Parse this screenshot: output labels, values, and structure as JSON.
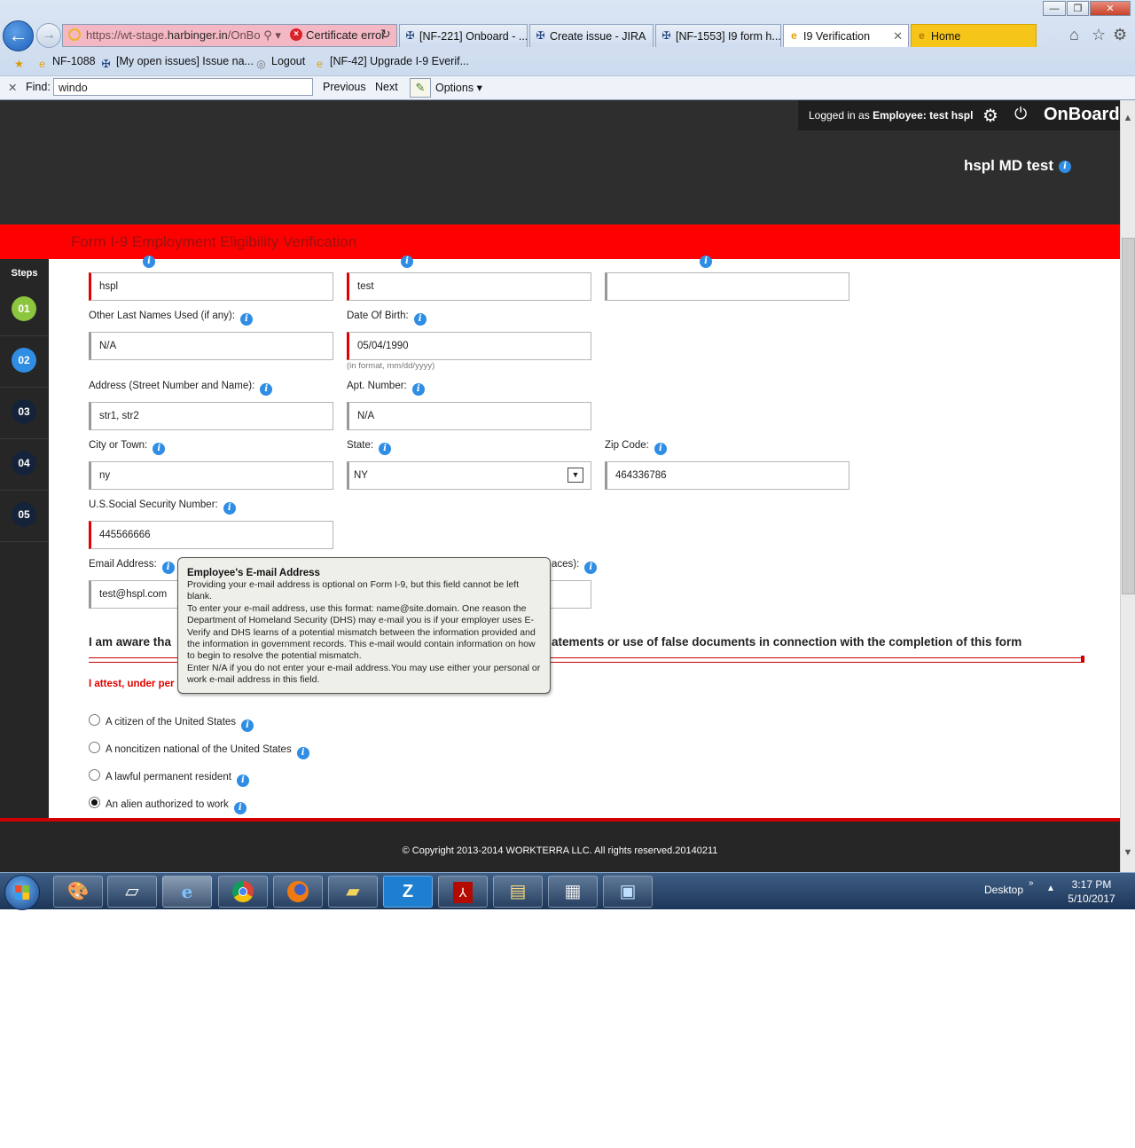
{
  "browser": {
    "url_prefix": "https://wt-stage.",
    "url_domain": "harbinger.in",
    "url_suffix": "/OnBo",
    "cert_error": "Certificate error",
    "tabs": [
      {
        "label": "[NF-221] Onboard - ..."
      },
      {
        "label": "Create issue - JIRA"
      },
      {
        "label": "[NF-1553] I9 form h..."
      },
      {
        "label": "I9 Verification"
      },
      {
        "label": "Home"
      }
    ],
    "favorites": [
      {
        "label": "NF-1088"
      },
      {
        "label": "[My open issues] Issue na..."
      },
      {
        "label": "Logout"
      },
      {
        "label": "[NF-42] Upgrade I-9 Everif..."
      }
    ],
    "find": {
      "label": "Find:",
      "value": "windo",
      "previous": "Previous",
      "next": "Next",
      "options": "Options"
    }
  },
  "header": {
    "logged_in_prefix": "Logged in as",
    "role": "Employee:",
    "user": "test hspl",
    "brand": "OnBoard",
    "company": "hspl MD test"
  },
  "form": {
    "title": "Form I-9 Employment Eligibility Verification",
    "steps_label": "Steps",
    "steps": [
      {
        "num": "01",
        "color": "#8cc63f"
      },
      {
        "num": "02",
        "color": "#2f8de4"
      },
      {
        "num": "03",
        "color": "#15233a"
      },
      {
        "num": "04",
        "color": "#15233a"
      },
      {
        "num": "05",
        "color": "#15233a"
      }
    ],
    "last_name": "hspl",
    "first_name": "test",
    "middle_initial": "",
    "other_last_names_label": "Other Last Names Used (if any):",
    "other_last_names": "N/A",
    "dob_label": "Date Of Birth:",
    "dob": "05/04/1990",
    "dob_hint": "(in format, mm/dd/yyyy)",
    "address_label": "Address (Street Number and Name):",
    "address": "str1, str2",
    "apt_label": "Apt. Number:",
    "apt": "N/A",
    "city_label": "City or Town:",
    "city": "ny",
    "state_label": "State:",
    "state": "NY",
    "zip_label": "Zip Code:",
    "zip": "464336786",
    "ssn_label": "U.S.Social Security Number:",
    "ssn": "445566666",
    "email_label": "Email Address:",
    "email": "test@hspl.com",
    "phone_label_tail": "aces):",
    "aware_text_left": "I am aware tha",
    "aware_text_right": "atements or use of false documents in connection with the completion of this form",
    "attest_text": "I attest, under per",
    "options": [
      {
        "label": "A citizen of the United States",
        "selected": false
      },
      {
        "label": "A noncitizen national of the United States",
        "selected": false
      },
      {
        "label": "A lawful permanent resident",
        "selected": false
      },
      {
        "label": "An alien authorized to work",
        "selected": true
      }
    ]
  },
  "tooltip": {
    "title": "Employee's E-mail Address",
    "body": "Providing your e-mail address is optional on Form I-9, but this field cannot be left blank.\nTo enter your e-mail address, use this format: name@site.domain. One reason the Department of Homeland Security (DHS) may e-mail you is if your employer uses E-Verify and DHS learns of a potential mismatch between the information provided and the information in government records. This e-mail would contain information on how to begin to resolve the potential mismatch.\nEnter N/A if you do not enter your e-mail address.You may use either your personal or work e-mail address in this field."
  },
  "footer": {
    "copyright": "© Copyright 2013-2014 WORKTERRA LLC. All rights reserved.20140211"
  },
  "taskbar": {
    "desktop_label": "Desktop",
    "time": "3:17 PM",
    "date": "5/10/2017"
  }
}
